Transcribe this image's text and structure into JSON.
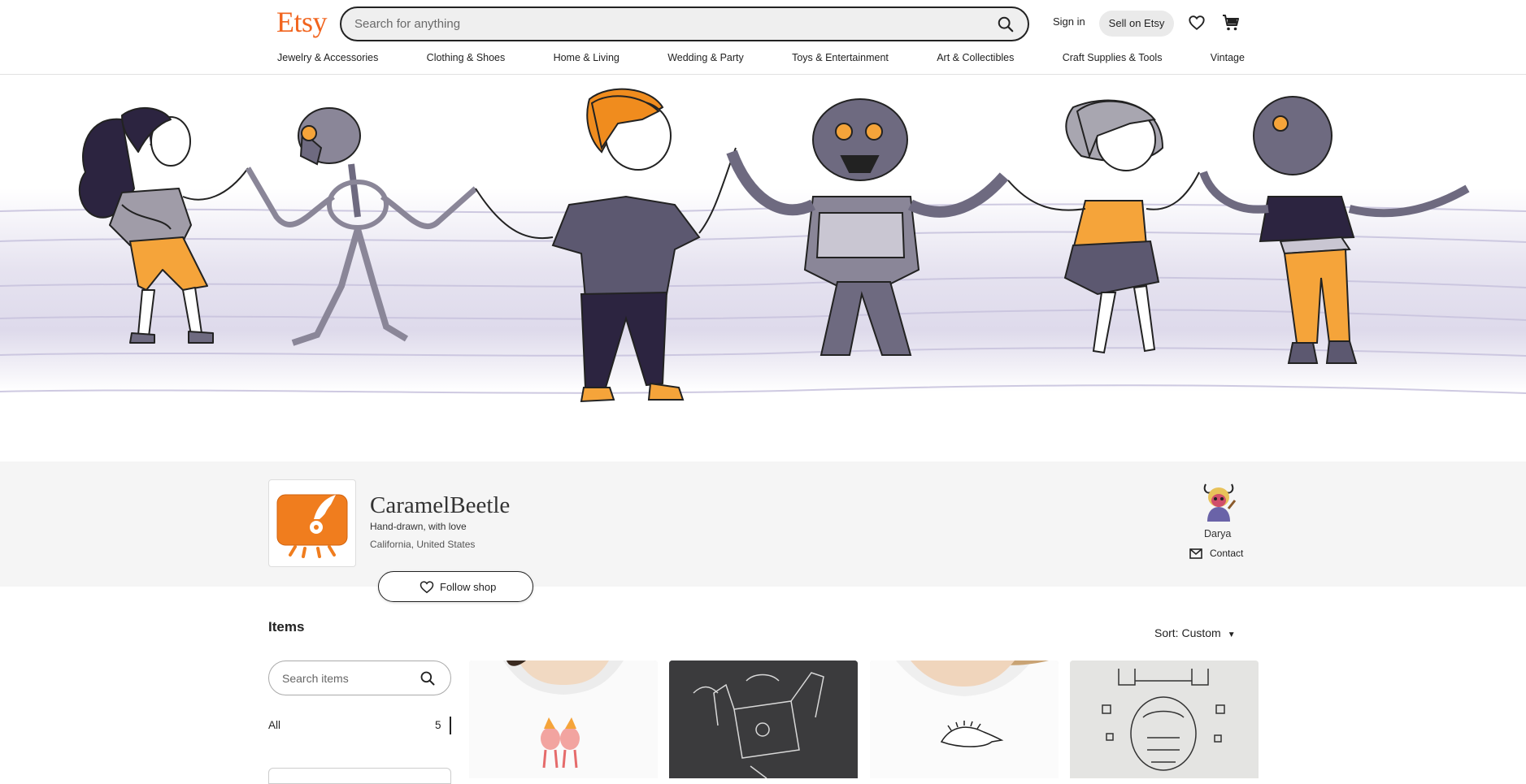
{
  "header": {
    "logo": "Etsy",
    "search_placeholder": "Search for anything",
    "sign_in": "Sign in",
    "sell": "Sell on Etsy",
    "icons": [
      "search-icon",
      "heart-icon",
      "cart-icon"
    ]
  },
  "nav": [
    "Jewelry & Accessories",
    "Clothing & Shoes",
    "Home & Living",
    "Wedding & Party",
    "Toys & Entertainment",
    "Art & Collectibles",
    "Craft Supplies & Tools",
    "Vintage"
  ],
  "shop": {
    "name": "CaramelBeetle",
    "tagline": "Hand-drawn, with love",
    "location": "California, United States",
    "follow": "Follow shop",
    "owner": "Darya",
    "contact": "Contact"
  },
  "items": {
    "title": "Items",
    "sort": "Sort: Custom",
    "search_placeholder": "Search items",
    "filters": [
      {
        "label": "All",
        "count": "5"
      }
    ]
  },
  "colors": {
    "brand": "#f1641e",
    "accent_orange": "#f5a43a",
    "ink": "#222222",
    "creature_gray": "#6e6a80",
    "wash": "#dcd8ea"
  }
}
